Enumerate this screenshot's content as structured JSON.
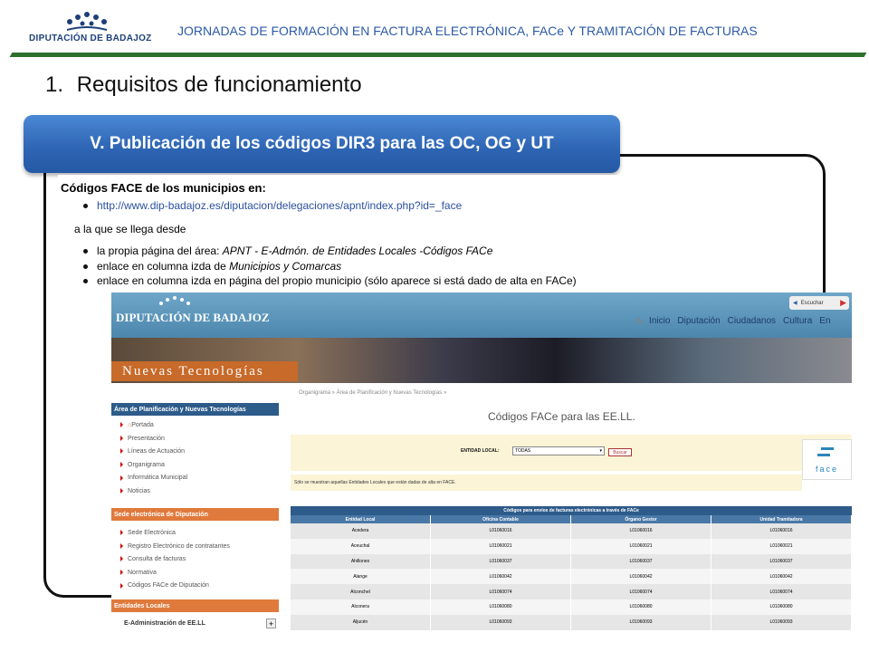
{
  "header": {
    "logo_text": "DIPUTACIÓN DE BADAJOZ",
    "title": "JORNADAS DE FORMACIÓN EN FACTURA ELECTRÓNICA, FACe Y TRAMITACIÓN DE FACTURAS"
  },
  "slide": {
    "section_number": "1.",
    "section_title": "Requisitos de funcionamiento",
    "banner": "V. Publicación de los códigos DIR3 para las OC, OG y UT"
  },
  "codes": {
    "heading": "Códigos FACE de los municipios en:",
    "link": "http://www.dip-badajoz.es/diputacion/delegaciones/apnt/index.php?id=_face",
    "reached_from": "a la que se llega desde",
    "bullet1_prefix": "la propia página del área:",
    "bullet1_italic": "APNT - E-Admón. de Entidades Locales -Códigos FACe",
    "bullet2_prefix": "enlace en columna izda de",
    "bullet2_italic": "Municipios y Comarcas",
    "bullet3": "enlace en columna izda en página del propio municipio (sólo aparece si está dado de alta en FACe)"
  },
  "web": {
    "logo_text": "DIPUTACIÓN DE BADAJOZ",
    "escuchar": "Escuchar",
    "nav": [
      "Inicio",
      "Diputación",
      "Ciudadanos",
      "Cultura",
      "En"
    ],
    "banner_label": "Nuevas Tecnologías",
    "breadcrumb": "Organigrama » Área de Planificación y Nuevas Tecnologías »",
    "page_heading": "Códigos FACe para las EE.LL.",
    "filter_label": "ENTIDAD LOCAL:",
    "filter_value": "TODAS",
    "search_button": "Buscar",
    "face_logo": "face",
    "notice": "Sólo se muestran aquellas Entidades Locales que están dadas de alta en FACE.",
    "sidebar": {
      "section1": "Área de Planificación y Nuevas Tecnologías",
      "section1_items": [
        "Portada",
        "Presentación",
        "Líneas de Actuación",
        "Organigrama",
        "Informática Municipal",
        "Noticias"
      ],
      "section2": "Sede electrónica de Diputación",
      "section2_items": [
        "Sede Electrónica",
        "Registro Electrónico de contratantes",
        "Consulta de facturas",
        "Normativa",
        "Códigos FACe de Diputación"
      ],
      "section3": "Entidades Locales",
      "section3_item": "E-Administración de EE.LL",
      "expand": "+"
    },
    "table": {
      "title": "Códigos para envíos de facturas electrónicas a través de FACe",
      "headers": [
        "Entidad Local",
        "Oficina Contable",
        "Órgano Gestor",
        "Unidad Tramitadora"
      ],
      "rows": [
        [
          "Acedera",
          "L01060016",
          "L01060016",
          "L01060016"
        ],
        [
          "Aceuchal",
          "L01060021",
          "L01060021",
          "L01060021"
        ],
        [
          "Ahillones",
          "L01060037",
          "L01060037",
          "L01060037"
        ],
        [
          "Alange",
          "L01060042",
          "L01060042",
          "L01060042"
        ],
        [
          "Alconchel",
          "L01060074",
          "L01060074",
          "L01060074"
        ],
        [
          "Alconera",
          "L01060080",
          "L01060080",
          "L01060080"
        ],
        [
          "Aljucén",
          "L01060093",
          "L01060093",
          "L01060093"
        ]
      ]
    }
  }
}
